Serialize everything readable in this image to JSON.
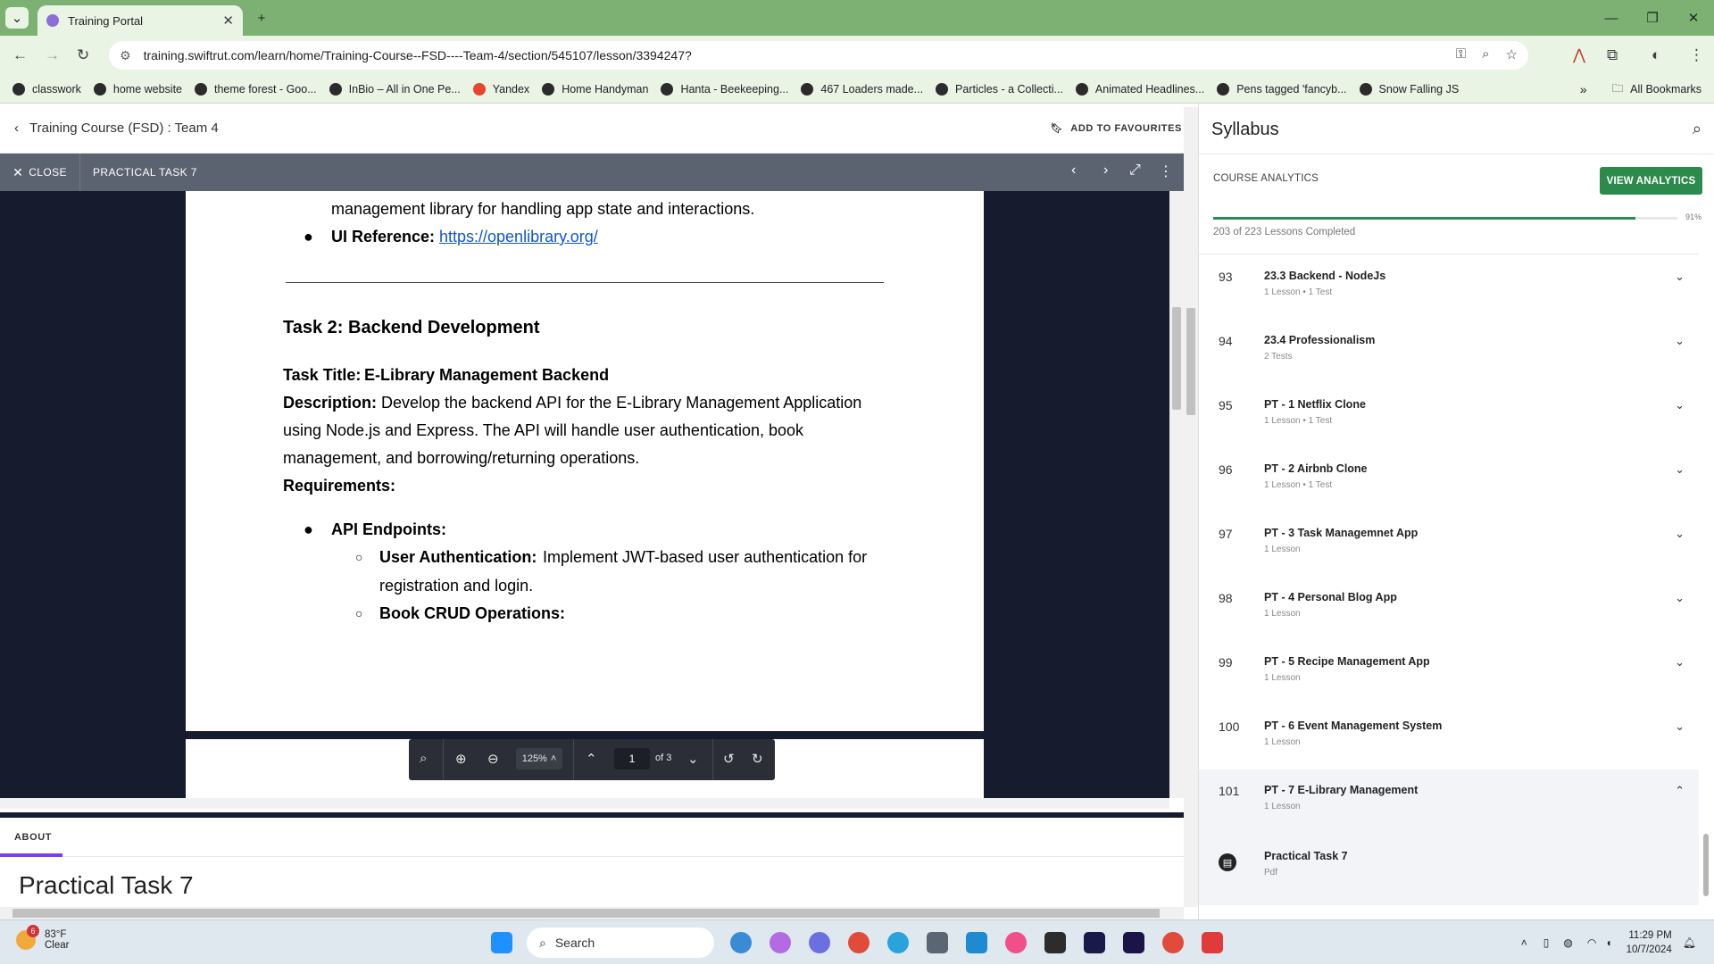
{
  "browser": {
    "tab_title": "Training Portal",
    "url": "training.swiftrut.com/learn/home/Training-Course--FSD----Team-4/section/545107/lesson/3394247?",
    "bookmarks": [
      {
        "label": "classwork"
      },
      {
        "label": "home website"
      },
      {
        "label": "theme forest - Goo..."
      },
      {
        "label": "InBio – All in One Pe..."
      },
      {
        "label": "Yandex"
      },
      {
        "label": "Home Handyman"
      },
      {
        "label": "Hanta - Beekeeping..."
      },
      {
        "label": "467 Loaders made..."
      },
      {
        "label": "Particles - a Collecti..."
      },
      {
        "label": "Animated Headlines..."
      },
      {
        "label": "Pens tagged 'fancyb..."
      },
      {
        "label": "Snow Falling JS"
      }
    ],
    "all_bookmarks": "All Bookmarks"
  },
  "header": {
    "breadcrumb": "Training Course (FSD) : Team 4",
    "favourites": "ADD TO FAVOURITES"
  },
  "viewer": {
    "close_label": "CLOSE",
    "title": "PRACTICAL TASK 7",
    "zoom": "125%",
    "page_current": "1",
    "page_total": "of 3"
  },
  "doc": {
    "line1": "management library for handling app state and interactions.",
    "ui_ref_label": "UI Reference:",
    "ui_ref_link": "https://openlibrary.org/",
    "task_heading": "Task 2: Backend Development",
    "task_title_label": "Task Title:",
    "task_title_value": "E-Library Management Backend",
    "desc_label": "Description:",
    "desc_line1": "Develop the backend API for the E-Library Management Application",
    "desc_line2": "using Node.js and Express. The API will handle user authentication, book",
    "desc_line3": "management, and borrowing/returning operations.",
    "requirements": "Requirements:",
    "api_endpoints": "API Endpoints:",
    "user_auth_label": "User Authentication:",
    "user_auth_text": "Implement JWT-based user authentication for",
    "user_auth_text2": "registration and login.",
    "book_crud": "Book CRUD Operations:"
  },
  "about": {
    "tab": "ABOUT",
    "lesson_title": "Practical Task 7"
  },
  "syllabus": {
    "title": "Syllabus",
    "course_analytics": "COURSE ANALYTICS",
    "view_analytics": "VIEW ANALYTICS",
    "progress_fraction": 0.91,
    "progress_pct": "91%",
    "progress_text": "203 of 223 Lessons Completed",
    "sections": [
      {
        "num": "93",
        "name": "23.3 Backend - NodeJs",
        "meta": "1 Lesson • 1 Test"
      },
      {
        "num": "94",
        "name": "23.4 Professionalism",
        "meta": "2 Tests"
      },
      {
        "num": "95",
        "name": "PT - 1 Netflix Clone",
        "meta": "1 Lesson • 1 Test"
      },
      {
        "num": "96",
        "name": "PT - 2 Airbnb Clone",
        "meta": "1 Lesson • 1 Test"
      },
      {
        "num": "97",
        "name": "PT - 3 Task Managemnet App",
        "meta": "1 Lesson"
      },
      {
        "num": "98",
        "name": "PT - 4 Personal Blog App",
        "meta": "1 Lesson"
      },
      {
        "num": "99",
        "name": "PT - 5 Recipe Management App",
        "meta": "1 Lesson"
      },
      {
        "num": "100",
        "name": "PT - 6 Event Management System",
        "meta": "1 Lesson"
      },
      {
        "num": "101",
        "name": "PT - 7 E-Library Management",
        "meta": "1 Lesson"
      }
    ],
    "lesson": {
      "name": "Practical Task 7",
      "type": "Pdf"
    }
  },
  "taskbar": {
    "weather_badge": "6",
    "temp": "83°F",
    "condition": "Clear",
    "search": "Search",
    "time": "11:29 PM",
    "date": "10/7/2024"
  }
}
